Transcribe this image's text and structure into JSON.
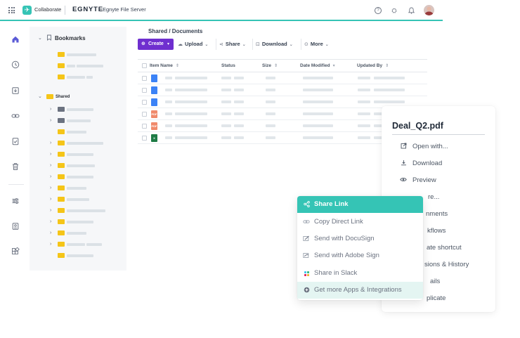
{
  "topbar": {
    "app_logo_glyph": "✈",
    "app_name": "Collaborate",
    "brand": "EGNYTE",
    "brand_sub": "Egnyte File Server",
    "icons": [
      "help-icon",
      "graduation-cap-icon",
      "bell-icon"
    ],
    "help_glyph": "?",
    "learn_glyph": "⛭",
    "bell_glyph": "♫"
  },
  "rail": {
    "home_glyph": "⌂",
    "recent_glyph": "◷",
    "inbox_glyph": "⊻",
    "link_glyph": "∞",
    "tasks_glyph": "☑",
    "trash_glyph": "▥",
    "settings_glyph": "☰",
    "reports_glyph": "◫",
    "apps_glyph": "❖"
  },
  "tree": {
    "bookmarks_label": "Bookmarks",
    "shared_label": "Shared"
  },
  "main": {
    "breadcrumb": "Shared / Documents",
    "toolbar": {
      "create": "Create",
      "upload": "Upload",
      "share": "Share",
      "download": "Download",
      "more": "More"
    },
    "table": {
      "headers": {
        "name": "Item Name",
        "status": "Status",
        "size": "Size",
        "modified": "Date Modified",
        "updated_by": "Updated By"
      },
      "rows": [
        {
          "type": "doc"
        },
        {
          "type": "doc"
        },
        {
          "type": "doc"
        },
        {
          "type": "pdf",
          "badge": "PDF"
        },
        {
          "type": "pdf",
          "badge": "PDF"
        },
        {
          "type": "xls",
          "badge": "X"
        }
      ]
    }
  },
  "details": {
    "title": "Deal_Q2.pdf",
    "items": [
      {
        "label": "Open with...",
        "glyph": "⇱"
      },
      {
        "label": "Download",
        "glyph": "⤓"
      },
      {
        "label": "Preview",
        "glyph": "◉"
      },
      {
        "label": "re...",
        "glyph": ""
      },
      {
        "label": "nments",
        "glyph": ""
      },
      {
        "label": "kflows",
        "glyph": ""
      },
      {
        "label": "ate shortcut",
        "glyph": ""
      },
      {
        "label": "sions & History",
        "glyph": ""
      },
      {
        "label": "ails",
        "glyph": ""
      },
      {
        "label": "plicate",
        "glyph": ""
      }
    ]
  },
  "share_menu": {
    "items": [
      {
        "label": "Share Link",
        "glyph": "⋖"
      },
      {
        "label": "Copy Direct Link",
        "glyph": "⊂⊃"
      },
      {
        "label": "Send with DocuSign",
        "glyph": "✍"
      },
      {
        "label": "Send with Adobe Sign",
        "glyph": "✎"
      },
      {
        "label": "Share in Slack",
        "glyph": ""
      },
      {
        "label": "Get more Apps & Integrations",
        "glyph": "⊕"
      }
    ]
  },
  "colors": {
    "accent_teal": "#35c4b5",
    "create_purple": "#6f2fcf",
    "folder_yellow": "#f5c518",
    "doc_blue": "#3b82f6",
    "pdf_orange": "#f08a6b",
    "xls_green": "#1e7b45"
  }
}
